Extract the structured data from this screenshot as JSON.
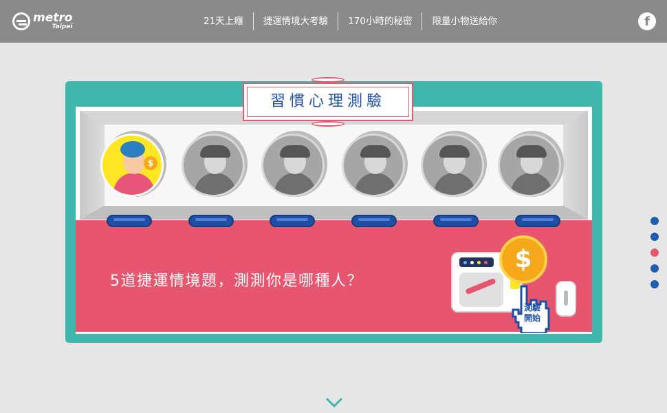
{
  "header": {
    "logo": {
      "name": "metro",
      "sub": "Taipei"
    },
    "nav": [
      {
        "label": "21天上癮"
      },
      {
        "label": "捷運情境大考驗"
      },
      {
        "label": "170小時的秘密"
      },
      {
        "label": "限量小物送給你"
      }
    ],
    "social": {
      "icon": "facebook-icon",
      "glyph": "f"
    }
  },
  "quiz": {
    "title": "習慣心理測驗",
    "question": "5道捷運情境題，測測你是哪種人？",
    "start_label_1": "測驗",
    "start_label_2": "開始",
    "dollar": "$",
    "coin_symbol": "$",
    "coins": [
      {
        "icon": "woman-with-coin-icon",
        "active": true
      },
      {
        "icon": "man-with-headphones-icon",
        "active": false
      },
      {
        "icon": "muscle-man-icon",
        "active": false
      },
      {
        "icon": "woman-wavy-hair-icon",
        "active": false
      },
      {
        "icon": "angry-devil-man-icon",
        "active": false
      },
      {
        "icon": "windblown-couple-icon",
        "active": false
      }
    ]
  },
  "pager": {
    "count": 5,
    "active_index": 2
  },
  "colors": {
    "header_bg": "#8a8a8a",
    "page_bg": "#e6e6e6",
    "teal": "#3fb7ac",
    "pink": "#e8556f",
    "blue": "#1e4fa5",
    "gold": "#f6a81a",
    "yellow": "#ffe623"
  }
}
